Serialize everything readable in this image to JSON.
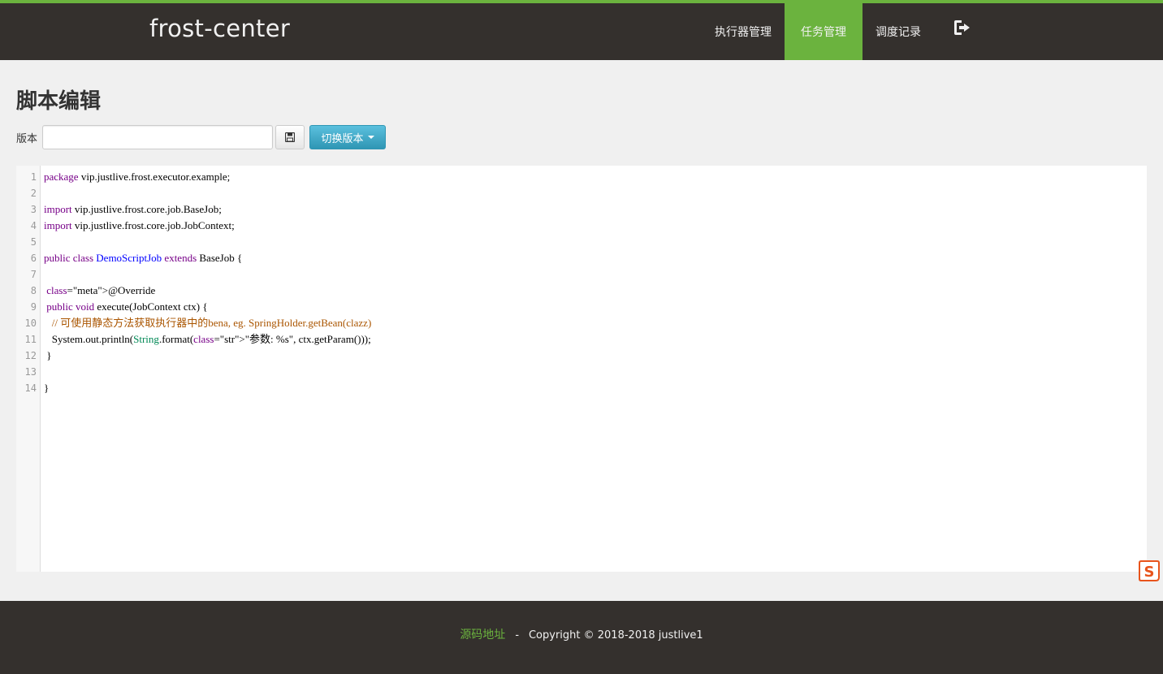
{
  "navbar": {
    "brand": "frost-center",
    "items": [
      {
        "label": "执行器管理",
        "active": false
      },
      {
        "label": "任务管理",
        "active": true
      },
      {
        "label": "调度记录",
        "active": false
      }
    ],
    "logout_icon": "sign-out-icon"
  },
  "page": {
    "title": "脚本编辑",
    "version_label": "版本",
    "version_value": "",
    "save_icon": "floppy-disk-icon",
    "switch_label": "切换版本"
  },
  "editor": {
    "line_numbers": [
      "1",
      "2",
      "3",
      "4",
      "5",
      "6",
      "7",
      "8",
      "9",
      "10",
      "11",
      "12",
      "13",
      "14"
    ],
    "lines": [
      "package vip.justlive.frost.executor.example;",
      "",
      "import vip.justlive.frost.core.job.BaseJob;",
      "import vip.justlive.frost.core.job.JobContext;",
      "",
      "public class DemoScriptJob extends BaseJob {",
      "",
      " @Override",
      " public void execute(JobContext ctx) {",
      "   // 可使用静态方法获取执行器中的bena, eg. SpringHolder.getBean(clazz)",
      "   System.out.println(String.format(\"参数: %s\", ctx.getParam()));",
      " }",
      "",
      "}"
    ]
  },
  "colors": {
    "brand_green": "#6bb33e",
    "navbar_bg": "#34302d",
    "page_bg": "#f0f0f0",
    "info_button": "#2f96b4"
  },
  "footer": {
    "link_label": "源码地址",
    "separator": "-",
    "copyright": "Copyright © 2018-2018 justlive1"
  }
}
